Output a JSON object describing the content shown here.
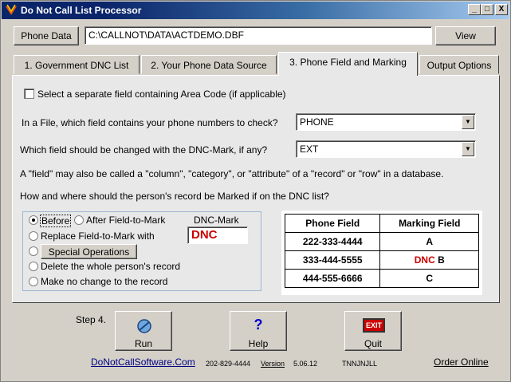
{
  "window": {
    "title": "Do Not Call List Processor"
  },
  "title_buttons": {
    "minimize": "_",
    "maximize": "□",
    "close": "X"
  },
  "file_row": {
    "phone_data_label": "Phone Data",
    "path_value": "C:\\CALLNOT\\DATA\\ACTDEMO.DBF",
    "view_label": "View"
  },
  "tabs": [
    {
      "label": "1. Government  DNC List",
      "active": false
    },
    {
      "label": "2. Your Phone Data Source",
      "active": false
    },
    {
      "label": "3. Phone Field and Marking",
      "active": true
    },
    {
      "label": "Output Options",
      "active": false
    }
  ],
  "panel": {
    "area_code_checkbox": {
      "label": "Select a separate field containing Area Code (if applicable)",
      "checked": false
    },
    "phone_field_question": "In a File, which field contains your phone numbers to check?",
    "phone_field_value": "PHONE",
    "mark_field_question": "Which field should be changed with the DNC-Mark, if any?",
    "mark_field_value": "EXT",
    "field_note": "A \"field\" may also be called a \"column\", \"category\", or \"attribute\" of a \"record\" or \"row\" in a database.",
    "how_question": "How and where should the person's  record be Marked if on the DNC list?",
    "options": {
      "before": "Before",
      "after": "After Field-to-Mark",
      "replace": "Replace Field-to-Mark with",
      "special_ops": "Special Operations",
      "delete": "Delete the whole person's record",
      "no_change": "Make no change to the record",
      "selected": "before"
    },
    "dnc_mark_label": "DNC-Mark",
    "dnc_mark_value": "DNC",
    "demo_table": {
      "headers": [
        "Phone Field",
        "Marking Field"
      ],
      "rows": [
        {
          "phone": "222-333-4444",
          "mark_prefix": "",
          "mark": "A"
        },
        {
          "phone": "333-444-5555",
          "mark_prefix": "DNC",
          "mark": "B"
        },
        {
          "phone": "444-555-6666",
          "mark_prefix": "",
          "mark": "C"
        }
      ]
    }
  },
  "footer": {
    "step_label": "Step 4.",
    "run_label": "Run",
    "help_label": "Help",
    "help_glyph": "?",
    "quit_label": "Quit",
    "exit_sign": "EXIT",
    "website": "DoNotCallSoftware.Com",
    "phone": "202-829-4444",
    "version_label": "Version",
    "version": "5.06.12",
    "code": "TNNJNJLL",
    "order_online": "Order Online"
  },
  "colors": {
    "dnc_red": "#cc0000",
    "title_blue": "#0a246a"
  },
  "icons": [
    "app-icon",
    "run-icon",
    "help-icon",
    "exit-sign-icon",
    "dropdown-arrow-icon"
  ]
}
